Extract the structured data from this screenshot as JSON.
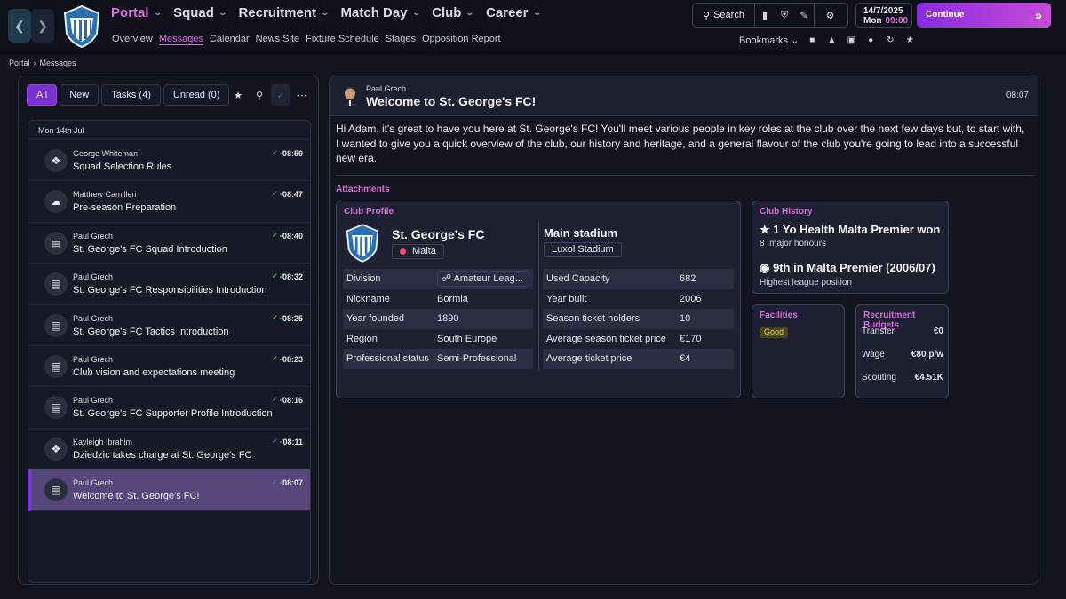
{
  "topbar": {
    "back_icon": "chevron-left-icon",
    "forward_icon": "chevron-right-icon",
    "main_nav": [
      "Portal",
      "Squad",
      "Recruitment",
      "Match Day",
      "Club",
      "Career"
    ],
    "sub_nav": [
      "Overview",
      "Messages",
      "Calendar",
      "News Site",
      "Fixture Schedule",
      "Stages",
      "Opposition Report"
    ],
    "search_label": "Search",
    "date": "14/7/2025",
    "day": "Mon",
    "time": "09:00",
    "continue_label": "Continue",
    "bookmarks_label": "Bookmarks",
    "accent_color": "#d66de0"
  },
  "breadcrumb": {
    "root": "Portal",
    "current": "Messages"
  },
  "inbox": {
    "tabs": [
      "All",
      "New",
      "Tasks (4)",
      "Unread (0)"
    ],
    "date_header": "Mon 14th Jul",
    "messages": [
      {
        "sender": "George Whiteman",
        "subject": "Squad Selection Rules",
        "time": "08:59"
      },
      {
        "sender": "Matthew Camilleri",
        "subject": "Pre-season Preparation",
        "time": "08:47"
      },
      {
        "sender": "Paul Grech",
        "subject": "St. George's FC Squad Introduction",
        "time": "08:40"
      },
      {
        "sender": "Paul Grech",
        "subject": "St. George's FC Responsibilities Introduction",
        "time": "08:32"
      },
      {
        "sender": "Paul Grech",
        "subject": "St. George's FC Tactics Introduction",
        "time": "08:25"
      },
      {
        "sender": "Paul Grech",
        "subject": "Club vision and expectations meeting",
        "time": "08:23"
      },
      {
        "sender": "Paul Grech",
        "subject": "St. George's FC Supporter Profile Introduction",
        "time": "08:16"
      },
      {
        "sender": "Kayleigh Ibrahim",
        "subject": "Dziedzic takes charge at St. George's FC",
        "time": "08:11"
      },
      {
        "sender": "Paul Grech",
        "subject": "Welcome to St. George's FC!",
        "time": "08:07"
      }
    ]
  },
  "message": {
    "from": "Paul Grech",
    "title": "Welcome to St. George's FC!",
    "time": "08:07",
    "body": "Hi Adam, it's great to have you here at St. George's FC! You'll meet various people in key roles at the club over the next few days but, to start with, I wanted to give you a quick overview of the club, our history and heritage, and a general flavour of the club you're going to lead into a successful new era.",
    "attachments_label": "Attachments"
  },
  "club_profile": {
    "title": "Club Profile",
    "name": "St. George's FC",
    "nation": "Malta",
    "stadium_label": "Main stadium",
    "stadium_name": "Luxol Stadium",
    "left_rows": [
      {
        "k": "Division",
        "v": "Amateur Leag..."
      },
      {
        "k": "Nickname",
        "v": "Bormla"
      },
      {
        "k": "Year founded",
        "v": "1890"
      },
      {
        "k": "Region",
        "v": "South Europe"
      },
      {
        "k": "Professional status",
        "v": "Semi-Professional"
      }
    ],
    "right_rows": [
      {
        "k": "Used Capacity",
        "v": "682"
      },
      {
        "k": "Year built",
        "v": "2006"
      },
      {
        "k": "Season ticket holders",
        "v": "10"
      },
      {
        "k": "Average season ticket price",
        "v": "€170"
      },
      {
        "k": "Average ticket price",
        "v": "€4"
      }
    ]
  },
  "club_history": {
    "title": "Club History",
    "honour_main": "1 Yo Health Malta Premier won",
    "honour_sub_count": "8",
    "honour_sub_label": "major honours",
    "league_main": "9th in Malta Premier (2006/07)",
    "league_sub": "Highest league position"
  },
  "facilities": {
    "title": "Facilities",
    "rating": "Good"
  },
  "recruitment_budgets": {
    "title": "Recruitment Budgets",
    "rows": [
      {
        "k": "Transfer",
        "v": "€0"
      },
      {
        "k": "Wage",
        "v": "€80 p/w"
      },
      {
        "k": "Scouting",
        "v": "€4.51K"
      }
    ]
  }
}
